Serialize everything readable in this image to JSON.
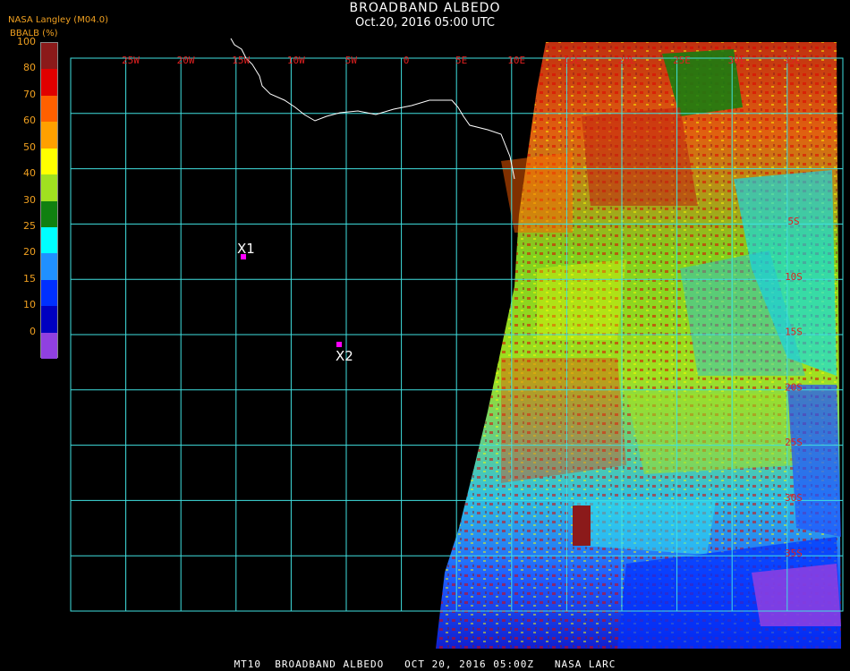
{
  "header": {
    "title": "BROADBAND ALBEDO",
    "datetime": "Oct.20, 2016 05:00 UTC",
    "producer": "NASA Langley (M04.0)"
  },
  "colorbar": {
    "label": "BBALB (%)",
    "ticks": [
      "100",
      "80",
      "70",
      "60",
      "50",
      "40",
      "30",
      "25",
      "20",
      "15",
      "10",
      "0"
    ],
    "colors": [
      "#8b1a1a",
      "#e00000",
      "#ff6000",
      "#ffa000",
      "#ffff00",
      "#a0e020",
      "#108010",
      "#00ffff",
      "#2090ff",
      "#0030ff",
      "#0000c0",
      "#9040e0"
    ]
  },
  "map": {
    "lon_labels": [
      "25W",
      "20W",
      "15W",
      "10W",
      "5W",
      "0",
      "5E",
      "10E",
      "15E",
      "20E",
      "25E",
      "30E",
      "35E"
    ],
    "lat_labels": [
      "5S",
      "10S",
      "15S",
      "20S",
      "25S",
      "30S",
      "35S"
    ],
    "sites": [
      {
        "label": "X1"
      },
      {
        "label": "X2"
      }
    ],
    "marker_color": "#ff00ff",
    "grid_color": "#40e0e0",
    "coast_color": "#ffffff"
  },
  "footer": {
    "text": "MT10  BROADBAND ALBEDO   OCT 20, 2016 05:00Z   NASA LARC"
  }
}
